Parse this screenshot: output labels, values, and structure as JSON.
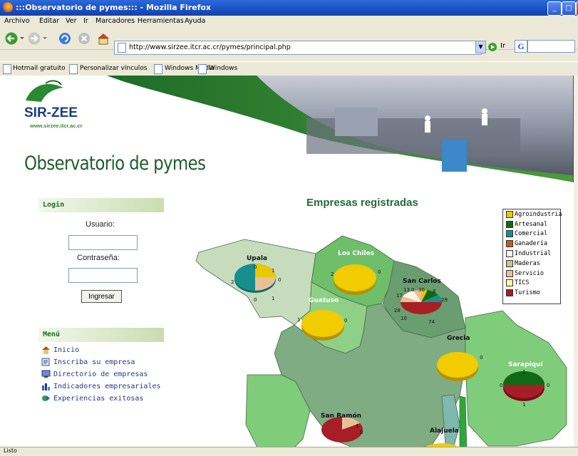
{
  "window": {
    "title": ":::Observatorio de pymes::: - Mozilla Firefox"
  },
  "menubar": [
    "Archivo",
    "Editar",
    "Ver",
    "Ir",
    "Marcadores",
    "Herramientas",
    "Ayuda"
  ],
  "navbar": {
    "url": "http://www.sirzee.itcr.ac.cr/pymes/principal.php",
    "go_label": "Ir",
    "search_icon": "G"
  },
  "bookmarks": [
    "Hotmail gratuito",
    "Personalizar vínculos",
    "Windows Media",
    "Windows"
  ],
  "page": {
    "logo": "SIR-ZEE",
    "logo_url": "www.sirzee.itcr.ac.cr",
    "title": "Observatorio de pymes",
    "login_header": "Login",
    "usuario_label": "Usuario:",
    "contrasena_label": "Contraseña:",
    "ingresar_label": "Ingresar",
    "menu_header": "Menú",
    "menu_items": [
      {
        "label": "Inicio",
        "icon": "home-icon"
      },
      {
        "label": "Inscriba su empresa",
        "icon": "register-icon"
      },
      {
        "label": "Directorio de empresas",
        "icon": "directory-icon"
      },
      {
        "label": "Indicadores empresariales",
        "icon": "chart-icon"
      },
      {
        "label": "Experiencias exitosas",
        "icon": "success-icon"
      }
    ]
  },
  "map": {
    "title": "Empresas registradas",
    "legend": [
      {
        "label": "Agroindustria",
        "color": "#e8c800"
      },
      {
        "label": "Artesanal",
        "color": "#0e6a14"
      },
      {
        "label": "Comercial",
        "color": "#168f8e"
      },
      {
        "label": "Ganadería",
        "color": "#c85a20"
      },
      {
        "label": "Industrial",
        "color": "#fff4e4"
      },
      {
        "label": "Maderas",
        "color": "#c8c48a"
      },
      {
        "label": "Servicio",
        "color": "#e8c098"
      },
      {
        "label": "TICS",
        "color": "#ffff9c"
      },
      {
        "label": "Turismo",
        "color": "#a81e26"
      }
    ],
    "regions": [
      {
        "name": "Upala",
        "labels": [
          "0",
          "1",
          "2",
          "0",
          "0",
          "1"
        ]
      },
      {
        "name": "Los Chiles",
        "labels": [
          "2",
          "0"
        ]
      },
      {
        "name": "San Carlos",
        "labels": [
          "13",
          "0",
          "30",
          "8",
          "17",
          "29",
          "28",
          "10",
          "74"
        ]
      },
      {
        "name": "Guatuso",
        "labels": [
          "1",
          "0"
        ]
      },
      {
        "name": "Grecia",
        "labels": [
          "0"
        ]
      },
      {
        "name": "Sarapiquí",
        "labels": [
          "1",
          "0",
          "0",
          "1"
        ]
      },
      {
        "name": "San Ramón",
        "labels": [
          "1",
          "0"
        ]
      },
      {
        "name": "Alajuela",
        "labels": []
      }
    ]
  },
  "status": "Listo"
}
